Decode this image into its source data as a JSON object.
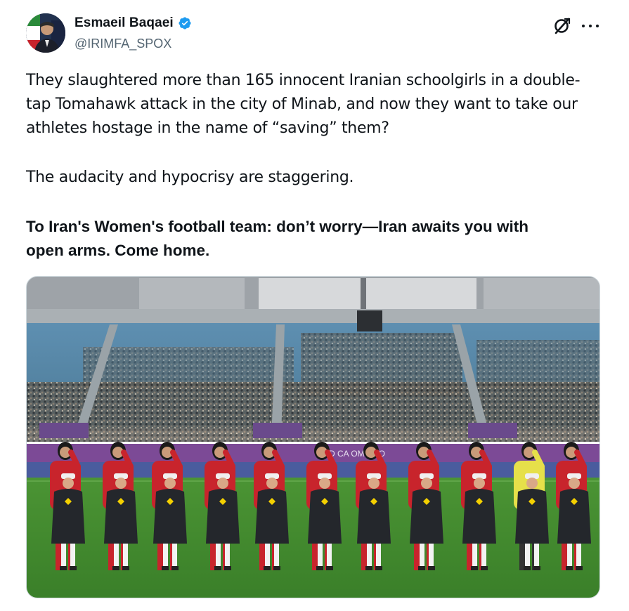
{
  "author": {
    "display_name": "Esmaeil Baqaei",
    "handle": "@IRIMFA_SPOX",
    "verified": true,
    "avatar_icon": "profile-photo"
  },
  "actions": {
    "grok_icon": "grok-icon",
    "more_icon": "more-options-icon"
  },
  "tweet": {
    "paragraph_1_line_1": "They slaughtered more than 165 innocent Iranian schoolgirls in a double-",
    "paragraph_1_line_2": "tap Tomahawk attack in the city of Minab, and now they want to take our",
    "paragraph_1_line_3": "athletes hostage in the name of “saving” them?",
    "paragraph_2": "The audacity and hypocrisy are staggering.",
    "paragraph_3_line_1": "To Iran's Women's football team: don’t worry—Iran awaits you with",
    "paragraph_3_line_2": "open arms. Come home."
  },
  "media": {
    "description_icon": "stadium-photo",
    "board_text": "D CA    OMB    CO"
  },
  "colors": {
    "verified_blue": "#1d9bf0",
    "kit_red": "#c8242c",
    "goalkeeper_yellow": "#e6e04a",
    "pitch_green": "#3f8a2f"
  }
}
